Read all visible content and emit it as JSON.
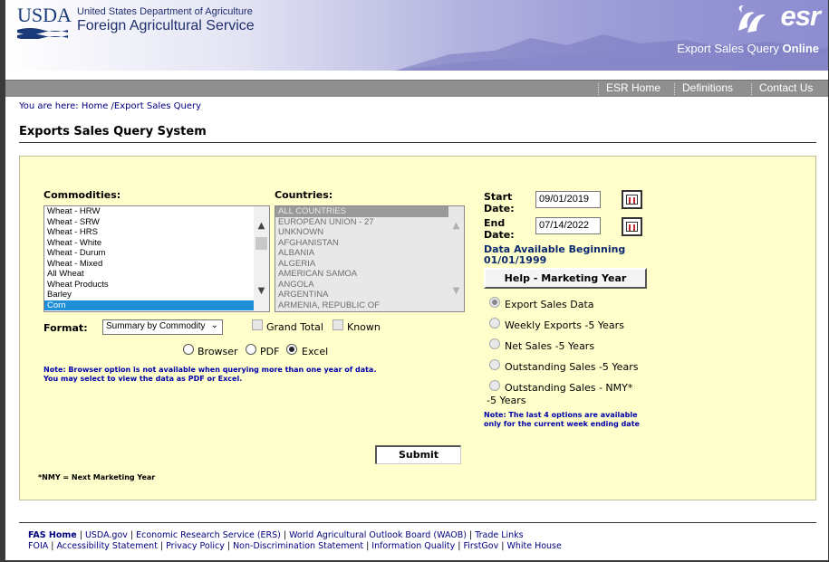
{
  "header": {
    "usda_logo_text": "USDA",
    "department": "United States Department of Agriculture",
    "agency": "Foreign Agricultural Service",
    "esr_logo_text": "esr",
    "app_tagline_main": "Export Sales Query ",
    "app_tagline_bold": "Online"
  },
  "nav": [
    {
      "label": "ESR Home"
    },
    {
      "label": "Definitions"
    },
    {
      "label": "Contact Us"
    }
  ],
  "breadcrumb": "You are here: Home /Export Sales Query",
  "page_title": "Exports Sales Query System",
  "form": {
    "commodities_label": "Commodities:",
    "commodities": [
      "Wheat - HRW",
      "Wheat - SRW",
      "Wheat - HRS",
      "Wheat - White",
      "Wheat - Durum",
      "Wheat - Mixed",
      "All Wheat",
      "Wheat Products",
      "Barley",
      "Corn"
    ],
    "commodities_selected": "Corn",
    "countries_label": "Countries:",
    "countries": [
      "ALL COUNTRIES",
      "EUROPEAN UNION - 27",
      "UNKNOWN",
      "AFGHANISTAN",
      "ALBANIA",
      "ALGERIA",
      "AMERICAN SAMOA",
      "ANGOLA",
      "ARGENTINA",
      "ARMENIA, REPUBLIC OF"
    ],
    "countries_selected": "ALL COUNTRIES",
    "format_label": "Format:",
    "format_value": "Summary by Commodity",
    "grand_total_label": "Grand Total",
    "known_label": "Known",
    "output_options": [
      "Browser",
      "PDF",
      "Excel"
    ],
    "output_selected": "Excel",
    "browser_note_line1": "Note: Browser option is not available when querying more than one year of data.",
    "browser_note_line2": "You may select to view the data as PDF or Excel.",
    "start_date_label_1": "Start",
    "start_date_label_2": "Date:",
    "start_date_value": "09/01/2019",
    "end_date_label_1": "End",
    "end_date_label_2": "Date:",
    "end_date_value": "07/14/2022",
    "data_available_line1": "Data Available Beginning",
    "data_available_line2": "01/01/1999",
    "help_button": "Help - Marketing Year",
    "report_options": [
      "Export Sales Data",
      "Weekly Exports -5 Years",
      "Net Sales -5 Years",
      "Outstanding Sales -5 Years",
      "Outstanding Sales - NMY*"
    ],
    "report_option_5_cont": "-5 Years",
    "report_selected": "Export Sales Data",
    "report_note_line1": "Note: The last 4 options are available",
    "report_note_line2": "only for the current week ending date",
    "submit_button": "Submit",
    "nmy_note": "*NMY = Next Marketing Year"
  },
  "footer": {
    "row1": [
      "FAS Home",
      "USDA.gov",
      "Economic Research Service (ERS)",
      "World Agricultural Outlook Board (WAOB)",
      "Trade Links"
    ],
    "row2": [
      "FOIA",
      "Accessibility Statement",
      "Privacy Policy",
      "Non-Discrimination Statement",
      "Information Quality",
      "FirstGov",
      "White House"
    ]
  },
  "colors": {
    "panel_bg": "#ffffcc",
    "nav_bg": "#8f8f8f",
    "link": "#000080",
    "note": "#0000aa",
    "selection": "#1e8fd6"
  }
}
